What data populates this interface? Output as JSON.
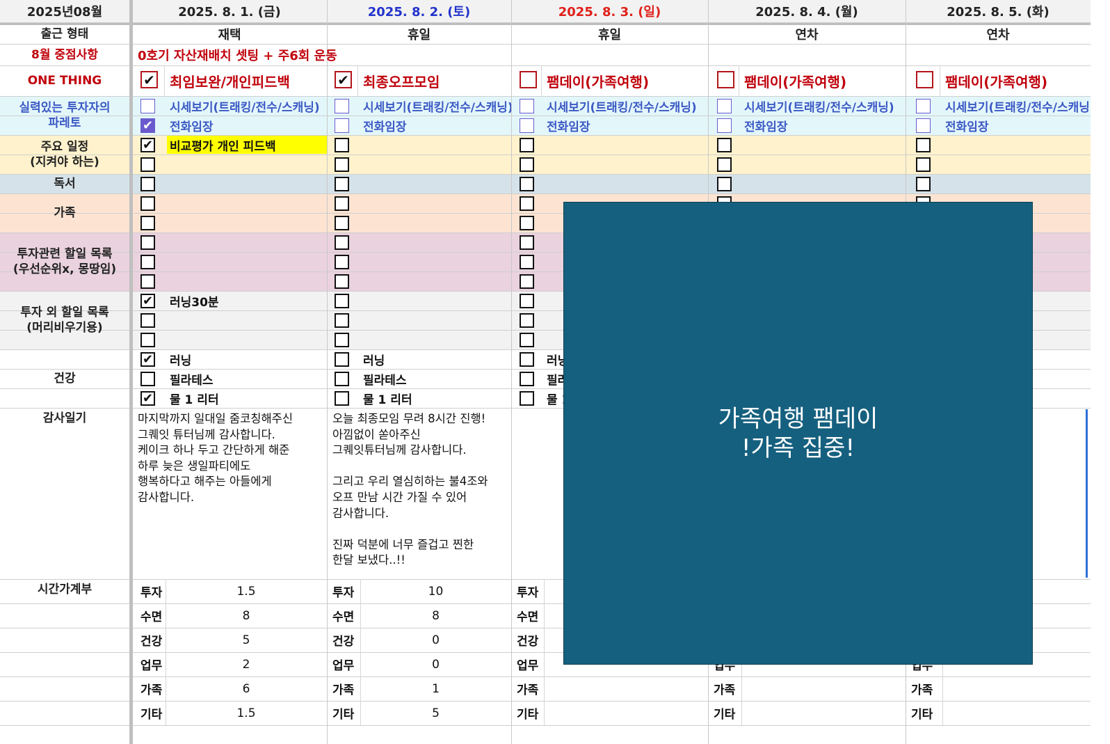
{
  "corner_title": "2025년08월",
  "row_labels": {
    "work_type": "출근 형태",
    "focus": "8월 중점사항",
    "one_thing": "ONE THING",
    "pareto": "실력있는 투자자의\n파레토",
    "schedule": "주요 일정\n(지켜야 하는)",
    "reading": "독서",
    "family": "가족",
    "invest_todo": "투자관련 할일 목록\n(우선순위x, 몽땅임)",
    "other_todo": "투자 외 할일 목록\n(머리비우기용)",
    "health": "건강",
    "gratitude": "감사일기",
    "time_budget": "시간가계부"
  },
  "focus_text": "0호기 자산재배치 셋팅 + 주6회 운동",
  "pareto_items": [
    "시세보기(트래킹/전수/스캐닝)",
    "전화임장"
  ],
  "health_items": [
    "러닝",
    "필라테스",
    "물 1 리터"
  ],
  "time_categories": [
    "투자",
    "수면",
    "건강",
    "업무",
    "가족",
    "기타"
  ],
  "days": [
    {
      "date": "2025. 8. 1. (금)",
      "date_color": "#222222",
      "work_type": "재택",
      "one_thing": "최임보완/개인피드백",
      "one_thing_checked": true,
      "pareto_checked": [
        false,
        true
      ],
      "schedule": [
        {
          "checked": true,
          "text": "비교평가 개인 피드백"
        },
        {
          "checked": false,
          "text": ""
        }
      ],
      "reading_checked": false,
      "family_checked": [
        false,
        false
      ],
      "invest_checked": [
        false,
        false,
        false
      ],
      "other": [
        {
          "checked": true,
          "text": "러닝30분"
        },
        {
          "checked": false,
          "text": ""
        },
        {
          "checked": false,
          "text": ""
        }
      ],
      "health_checked": [
        true,
        false,
        true
      ],
      "gratitude": "마지막까지 일대일 줌코칭해주신\n그퀘잇 튜터님께 감사합니다.\n케이크 하나 두고 간단하게 해준\n하루 늦은 생일파티에도\n행복하다고 해주는 아들에게\n감사합니다.",
      "time_values": [
        "1.5",
        "8",
        "5",
        "2",
        "6",
        "1.5"
      ]
    },
    {
      "date": "2025. 8. 2. (토)",
      "date_color": "#2233cc",
      "work_type": "휴일",
      "one_thing": "최종오프모임",
      "one_thing_checked": true,
      "pareto_checked": [
        false,
        false
      ],
      "schedule": [
        {
          "checked": false,
          "text": ""
        },
        {
          "checked": false,
          "text": ""
        }
      ],
      "reading_checked": false,
      "family_checked": [
        false,
        false
      ],
      "invest_checked": [
        false,
        false,
        false
      ],
      "other": [
        {
          "checked": false,
          "text": ""
        },
        {
          "checked": false,
          "text": ""
        },
        {
          "checked": false,
          "text": ""
        }
      ],
      "health_checked": [
        false,
        false,
        false
      ],
      "gratitude": "오늘 최종모임 무려 8시간 진행!\n아낌없이 쏟아주신\n그퀘잇튜터님께 감사합니다.\n\n그리고 우리 열심히하는 불4조와\n오프 만남 시간 가질 수 있어\n감사합니다.\n\n진짜 덕분에 너무 즐겁고 찐한\n한달 보냈다..!!",
      "time_values": [
        "10",
        "8",
        "0",
        "0",
        "1",
        "5"
      ]
    },
    {
      "date": "2025. 8. 3. (일)",
      "date_color": "#e0201a",
      "work_type": "휴일",
      "one_thing": "팸데이(가족여행)",
      "one_thing_checked": false,
      "pareto_checked": [
        false,
        false
      ],
      "schedule": [
        {
          "checked": false,
          "text": ""
        },
        {
          "checked": false,
          "text": ""
        }
      ],
      "reading_checked": false,
      "family_checked": [
        false,
        false
      ],
      "invest_checked": [
        false,
        false,
        false
      ],
      "other": [
        {
          "checked": false,
          "text": ""
        },
        {
          "checked": false,
          "text": ""
        },
        {
          "checked": false,
          "text": ""
        }
      ],
      "health_checked": [
        false,
        false,
        false
      ],
      "gratitude": "",
      "time_values": [
        "",
        "",
        "",
        "",
        "",
        ""
      ]
    },
    {
      "date": "2025. 8. 4. (월)",
      "date_color": "#222222",
      "work_type": "연차",
      "one_thing": "팸데이(가족여행)",
      "one_thing_checked": false,
      "pareto_checked": [
        false,
        false
      ],
      "schedule": [
        {
          "checked": false,
          "text": ""
        },
        {
          "checked": false,
          "text": ""
        }
      ],
      "reading_checked": false,
      "family_checked": [
        false,
        false
      ],
      "invest_checked": [
        false,
        false,
        false
      ],
      "other": [
        {
          "checked": false,
          "text": ""
        },
        {
          "checked": false,
          "text": ""
        },
        {
          "checked": false,
          "text": ""
        }
      ],
      "health_checked": [
        false,
        false,
        false
      ],
      "gratitude": "",
      "time_values": [
        "",
        "",
        "",
        "",
        "",
        ""
      ]
    },
    {
      "date": "2025. 8. 5. (화)",
      "date_color": "#222222",
      "work_type": "연차",
      "one_thing": "팸데이(가족여행)",
      "one_thing_checked": false,
      "pareto_checked": [
        false,
        false
      ],
      "schedule": [
        {
          "checked": false,
          "text": ""
        },
        {
          "checked": false,
          "text": ""
        }
      ],
      "reading_checked": false,
      "family_checked": [
        false,
        false
      ],
      "invest_checked": [
        false,
        false,
        false
      ],
      "other": [
        {
          "checked": false,
          "text": ""
        },
        {
          "checked": false,
          "text": ""
        },
        {
          "checked": false,
          "text": ""
        }
      ],
      "health_checked": [
        false,
        false,
        false
      ],
      "gratitude": "",
      "time_values": [
        "",
        "",
        "",
        "",
        "",
        ""
      ]
    }
  ],
  "overlay": {
    "line1": "가족여행 팸데이",
    "line2": "!가족 집중!"
  },
  "colors": {
    "header_bg": "#f2f2f2",
    "label_red": "#c0000b",
    "label_blue": "#3b58c4",
    "pareto_bg": "#e3f7fb",
    "schedule_bg": "#fff2cc",
    "reading_bg": "#d5e2ea",
    "family_bg": "#fde4d2",
    "invest_bg": "#ead2de",
    "other_bg": "#f2f2f2",
    "highlight": "#ffff00",
    "overlay_bg": "#16607f"
  }
}
